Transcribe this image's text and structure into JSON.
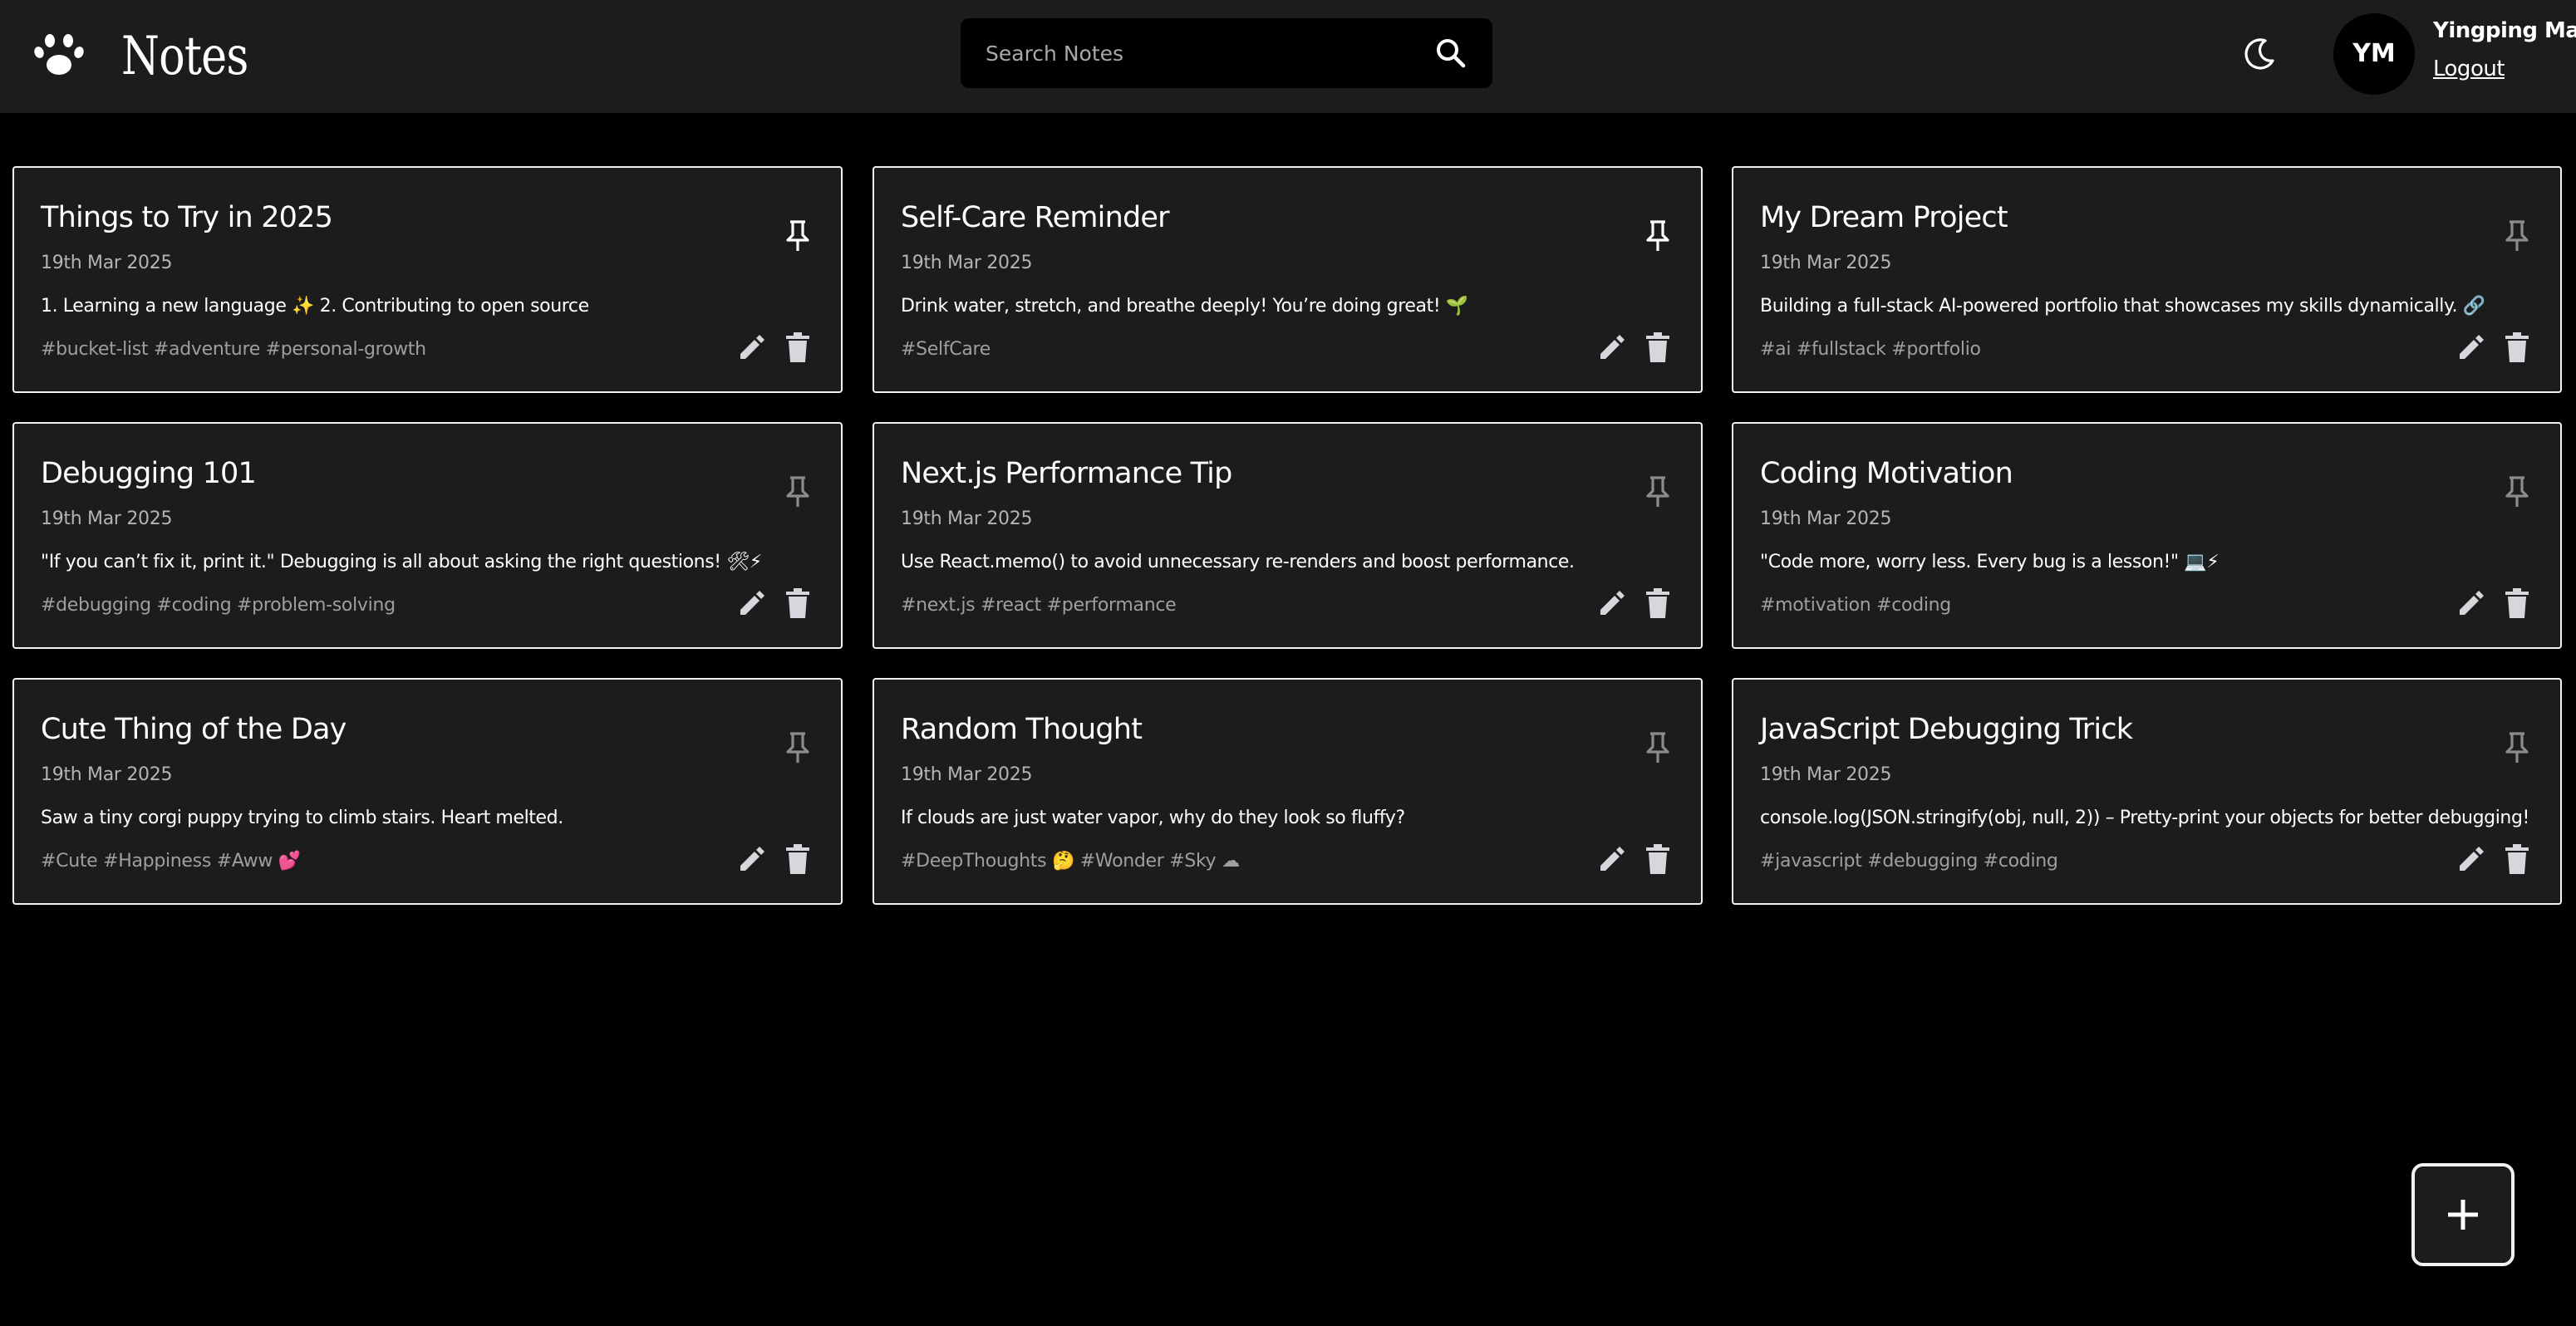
{
  "header": {
    "logo_icon": "paw-icon",
    "title": "Notes",
    "search": {
      "placeholder": "Search Notes",
      "value": "",
      "icon": "search-icon"
    },
    "theme_toggle_icon": "moon-icon",
    "user": {
      "initials": "YM",
      "name": "Yingping Ma",
      "logout_label": "Logout"
    }
  },
  "notes": [
    {
      "title": "Things to Try in 2025",
      "date": "19th Mar 2025",
      "content": "1. Learning a new language ✨ 2. Contributing to open source",
      "tags": "#bucket-list #adventure #personal-growth",
      "pinned": true
    },
    {
      "title": "Self-Care Reminder",
      "date": "19th Mar 2025",
      "content": "Drink water, stretch, and breathe deeply! You’re doing great! 🌱",
      "tags": "#SelfCare",
      "pinned": true
    },
    {
      "title": "My Dream Project",
      "date": "19th Mar 2025",
      "content": "Building a full-stack AI-powered portfolio that showcases my skills dynamically. 🔗",
      "tags": "#ai #fullstack #portfolio",
      "pinned": false
    },
    {
      "title": "Debugging 101",
      "date": "19th Mar 2025",
      "content": "\"If you can’t fix it, print it.\" Debugging is all about asking the right questions! 🛠⚡",
      "tags": "#debugging #coding #problem-solving",
      "pinned": false
    },
    {
      "title": "Next.js Performance Tip",
      "date": "19th Mar 2025",
      "content": "Use React.memo() to avoid unnecessary re-renders and boost performance.",
      "tags": "#next.js #react #performance",
      "pinned": false
    },
    {
      "title": "Coding Motivation",
      "date": "19th Mar 2025",
      "content": "\"Code more, worry less. Every bug is a lesson!\" 💻⚡",
      "tags": "#motivation #coding",
      "pinned": false
    },
    {
      "title": "Cute Thing of the Day",
      "date": "19th Mar 2025",
      "content": "Saw a tiny corgi puppy trying to climb stairs. Heart melted.",
      "tags": "#Cute #Happiness #Aww 💕",
      "pinned": false
    },
    {
      "title": "Random Thought",
      "date": "19th Mar 2025",
      "content": "If clouds are just water vapor, why do they look so fluffy?",
      "tags": "#DeepThoughts 🤔 #Wonder #Sky ☁",
      "pinned": false
    },
    {
      "title": "JavaScript Debugging Trick",
      "date": "19th Mar 2025",
      "content": "console.log(JSON.stringify(obj, null, 2)) – Pretty-print your objects for better debugging!",
      "tags": "#javascript #debugging #coding",
      "pinned": false
    }
  ],
  "card_icons": {
    "pin": "pin-icon",
    "edit": "pencil-icon",
    "delete": "trash-icon"
  },
  "add_button_icon": "plus-icon",
  "colors": {
    "background": "#000000",
    "surface": "#1c1c1d",
    "card_border": "#f2f2ee",
    "text": "#ffffff",
    "muted_text": "#b4b4b8",
    "tag_text": "#9e9ea3",
    "icon_active": "#ffffff",
    "icon_muted": "#8c8c90",
    "action_icon": "#d6d6dc"
  }
}
